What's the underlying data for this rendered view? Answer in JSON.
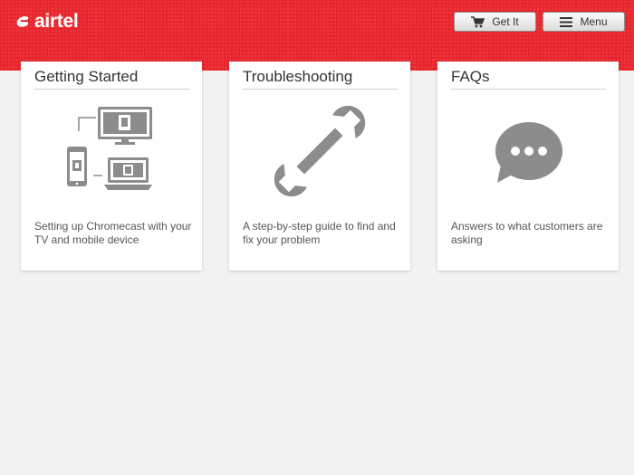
{
  "header": {
    "logo_text": "airtel",
    "get_it_label": "Get It",
    "menu_label": "Menu"
  },
  "cards": [
    {
      "title": "Getting Started",
      "description": "Setting up Chromecast with your TV and mobile device",
      "icon": "devices-icon"
    },
    {
      "title": "Troubleshooting",
      "description": "A step-by-step guide to find and fix your problem",
      "icon": "wrench-icon"
    },
    {
      "title": "FAQs",
      "description": "Answers to what customers are asking",
      "icon": "speech-bubble-icon"
    }
  ],
  "colors": {
    "brand_red": "#e8262d",
    "icon_grey": "#8c8c8c"
  }
}
